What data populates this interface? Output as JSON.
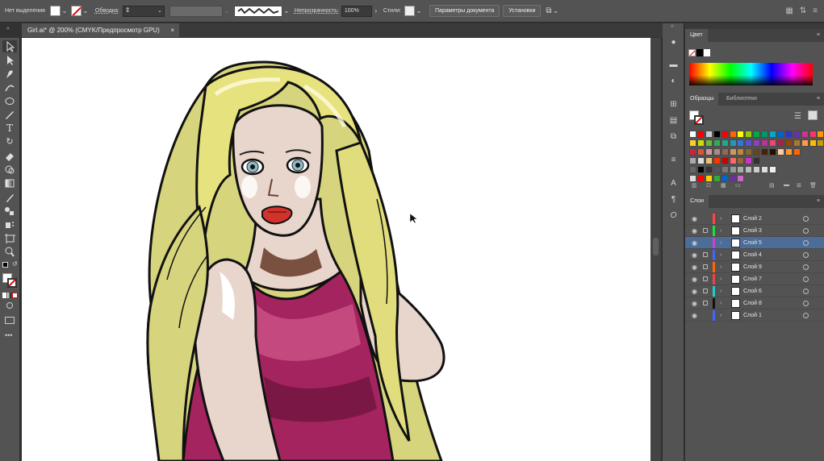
{
  "control_bar": {
    "no_selection": "Нет выделения",
    "stroke_label": "Обводка:",
    "opacity_label": "Непрозрачность:",
    "opacity_value": "100%",
    "styles_label": "Стили:",
    "doc_setup": "Параметры документа",
    "preferences": "Установки",
    "stroke_weight": "",
    "fill_color": "#ffffff"
  },
  "tab": {
    "title": "Girl.ai* @ 200% (CMYK/Предпросмотр GPU)",
    "close": "×"
  },
  "color_panel": {
    "title": "Цвет"
  },
  "swatches_panel": {
    "tab_swatches": "Образцы",
    "tab_libraries": "Библиотеки",
    "rows": [
      [
        "#ffffff",
        "#ff0000",
        "#cccccc",
        "#000000",
        "#ff0000",
        "#ff6600",
        "#ffff00",
        "#99cc00",
        "#00aa44",
        "#009966",
        "#00aacc",
        "#0066cc",
        "#3333cc",
        "#6633aa",
        "#cc3399",
        "#ff3366",
        "#ff9900"
      ],
      [
        "#ffcc33",
        "#ccdd00",
        "#66bb33",
        "#33aa55",
        "#22aa88",
        "#2299bb",
        "#3377dd",
        "#5555cc",
        "#8844bb",
        "#bb3399",
        "#ee4477",
        "#aa2244",
        "#994400",
        "#aa7733",
        "#ff9944",
        "#ffbb00",
        "#cc9900"
      ],
      [
        "#cc2244",
        "#dd5533",
        "#cc9999",
        "#aa8888",
        "#996655",
        "#cc9966",
        "#bb8844",
        "#886633",
        "#664422",
        "#442211",
        "#221100",
        "#ffcc99",
        "#ff9933",
        "#ff6600"
      ],
      [
        "#aaaaaa",
        "#dddddd",
        "#e8c070",
        "#ff3300",
        "#cc0000",
        "#ff6666",
        "#996633",
        "#cc33cc",
        "#333333"
      ],
      [
        "#666666",
        "#000000",
        "#333333",
        "#555555",
        "#777777",
        "#999999",
        "#aaaaaa",
        "#bbbbbb",
        "#cccccc",
        "#dddddd",
        "#eeeeee"
      ],
      [
        "#dddddd",
        "#ff0000",
        "#ffcc00",
        "#33aa33",
        "#0066cc",
        "#663399",
        "#cc66cc"
      ]
    ]
  },
  "layers_panel": {
    "title": "Слои",
    "layers": [
      {
        "name": "Слой 2",
        "color": "#ff4444",
        "locked": false,
        "selected": false
      },
      {
        "name": "Слой 3",
        "color": "#22dd44",
        "locked": true,
        "selected": false
      },
      {
        "name": "Слой 5",
        "color": "#cc44cc",
        "locked": false,
        "selected": true
      },
      {
        "name": "Слой 4",
        "color": "#4466ff",
        "locked": true,
        "selected": false
      },
      {
        "name": "Слой 9",
        "color": "#ff6600",
        "locked": true,
        "selected": false
      },
      {
        "name": "Слой 7",
        "color": "#ee4444",
        "locked": true,
        "selected": false
      },
      {
        "name": "Слой 6",
        "color": "#22cccc",
        "locked": true,
        "selected": false
      },
      {
        "name": "Слой 8",
        "color": "#111111",
        "locked": true,
        "selected": false
      },
      {
        "name": "Слой 1",
        "color": "#4466ff",
        "locked": false,
        "selected": false
      }
    ]
  },
  "colors": {
    "accent": "#4b6d98",
    "workspace": "#323232",
    "panel": "#535353"
  }
}
